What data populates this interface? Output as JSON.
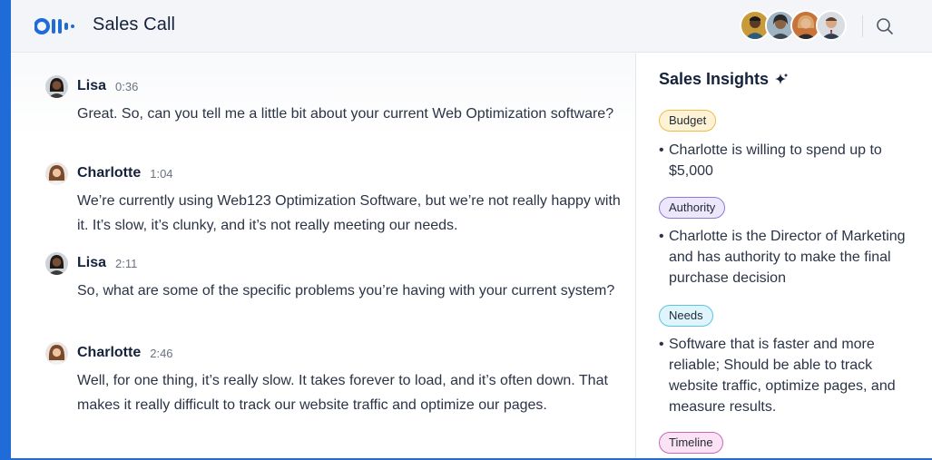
{
  "header": {
    "title": "Sales Call",
    "avatars": [
      {
        "label": "participant-1"
      },
      {
        "label": "participant-2"
      },
      {
        "label": "participant-3"
      },
      {
        "label": "participant-4"
      }
    ]
  },
  "transcript": [
    {
      "speaker": "Lisa",
      "time": "0:36",
      "text": "Great. So, can you tell me a little bit about your current Web Optimization software?"
    },
    {
      "speaker": "Charlotte",
      "time": "1:04",
      "text": "We’re currently using Web123 Optimization Software, but we’re not really happy with it. It’s slow, it’s clunky, and it’s not really meeting our needs."
    },
    {
      "speaker": "Lisa",
      "time": "2:11",
      "text": "So, what are some of the specific problems you’re having with your current system?"
    },
    {
      "speaker": "Charlotte",
      "time": "2:46",
      "text": "Well, for one thing, it’s really slow. It takes forever to load, and it’s often down. That makes it really difficult to track our website traffic and optimize our pages."
    }
  ],
  "insights": {
    "title": "Sales Insights",
    "items": [
      {
        "tag": "Budget",
        "text": "Charlotte is willing to spend up to $5,000"
      },
      {
        "tag": "Authority",
        "text": "Charlotte is the Director of Marketing and has authority to make the final purchase decision"
      },
      {
        "tag": "Needs",
        "text": "Software that is faster and more reliable; Should be able to track website traffic, optimize pages, and measure results."
      },
      {
        "tag": "Timeline",
        "text": ""
      }
    ]
  },
  "colors": {
    "brand": "#1f6cd9",
    "budget": "#f2b84b",
    "authority": "#8f7ad6",
    "needs": "#5cc3e3",
    "timeline": "#c86ab8"
  }
}
